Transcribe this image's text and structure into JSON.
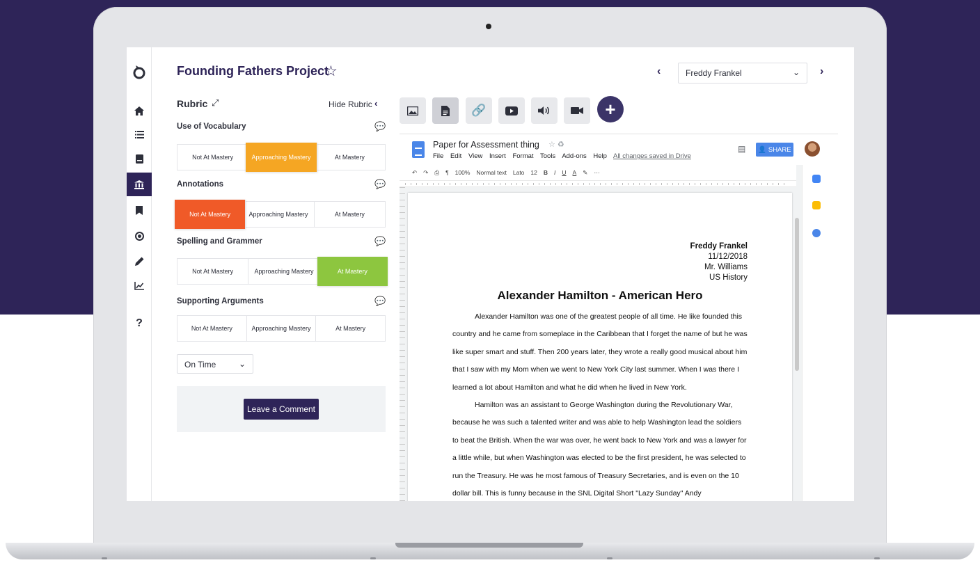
{
  "app": {
    "project_title": "Founding Fathers Project",
    "student": "Freddy Frankel"
  },
  "rail": {
    "icons": [
      "logo-icon",
      "home-icon",
      "list-icon",
      "book-icon",
      "building-icon",
      "bookmark-icon",
      "record-icon",
      "pencil-icon",
      "chart-icon",
      "help-icon"
    ],
    "help_label": "?"
  },
  "rubric": {
    "title": "Rubric",
    "hide_label": "Hide Rubric",
    "levels": [
      "Not At Mastery",
      "Approaching Mastery",
      "At Mastery"
    ],
    "criteria": [
      {
        "name": "Use of Vocabulary",
        "selected": 1,
        "selected_color": "#f5a623"
      },
      {
        "name": "Annotations",
        "selected": 0,
        "selected_color": "#f05a28"
      },
      {
        "name": "Spelling and Grammer",
        "selected": 2,
        "selected_color": "#8dc63f"
      },
      {
        "name": "Supporting Arguments",
        "selected": -1,
        "selected_color": ""
      }
    ],
    "timeliness": "On Time",
    "comment_button": "Leave a Comment"
  },
  "media_toolbar": {
    "buttons": [
      "image-icon",
      "document-icon",
      "link-icon",
      "video-icon",
      "audio-icon",
      "camera-icon",
      "add-icon"
    ],
    "active": "document-icon"
  },
  "doc": {
    "title": "Paper for Assessment thing",
    "menu": [
      "File",
      "Edit",
      "View",
      "Insert",
      "Format",
      "Tools",
      "Add-ons",
      "Help"
    ],
    "saved_status": "All changes saved in Drive",
    "share_label": "SHARE",
    "toolbar": {
      "zoom": "100%",
      "style": "Normal text",
      "font": "Lato",
      "size": "12"
    },
    "heading_lines": [
      "Freddy Frankel",
      "11/12/2018",
      "Mr. Williams",
      "US History"
    ],
    "essay_title": "Alexander Hamilton - American Hero",
    "paragraphs": [
      "Alexander Hamilton was one of the greatest people of all time. He like founded this country and he came from someplace in the Caribbean that I forget the name of but he was like super smart and stuff. Then 200 years later, they wrote a really good musical about him that I saw with my Mom when we went to New York City last summer. When I was there I learned a lot about Hamilton and what he did when he lived in New York.",
      "Hamilton was an assistant to George Washington during the Revolutionary War, because he was such a talented writer and was able to help Washington lead the soldiers to beat the British. When the war was over, he went back to New York and was a lawyer for a little while, but when Washington was elected to be the first president, he was selected to run the Treasury. He was he most famous of Treasury Secretaries, and is even on the 10 dollar bill. This is funny because in the SNL Digital Short \"Lazy Sunday\" Andy"
    ]
  },
  "colors": {
    "brand": "#2e2458",
    "google_blue": "#4a86e8"
  }
}
